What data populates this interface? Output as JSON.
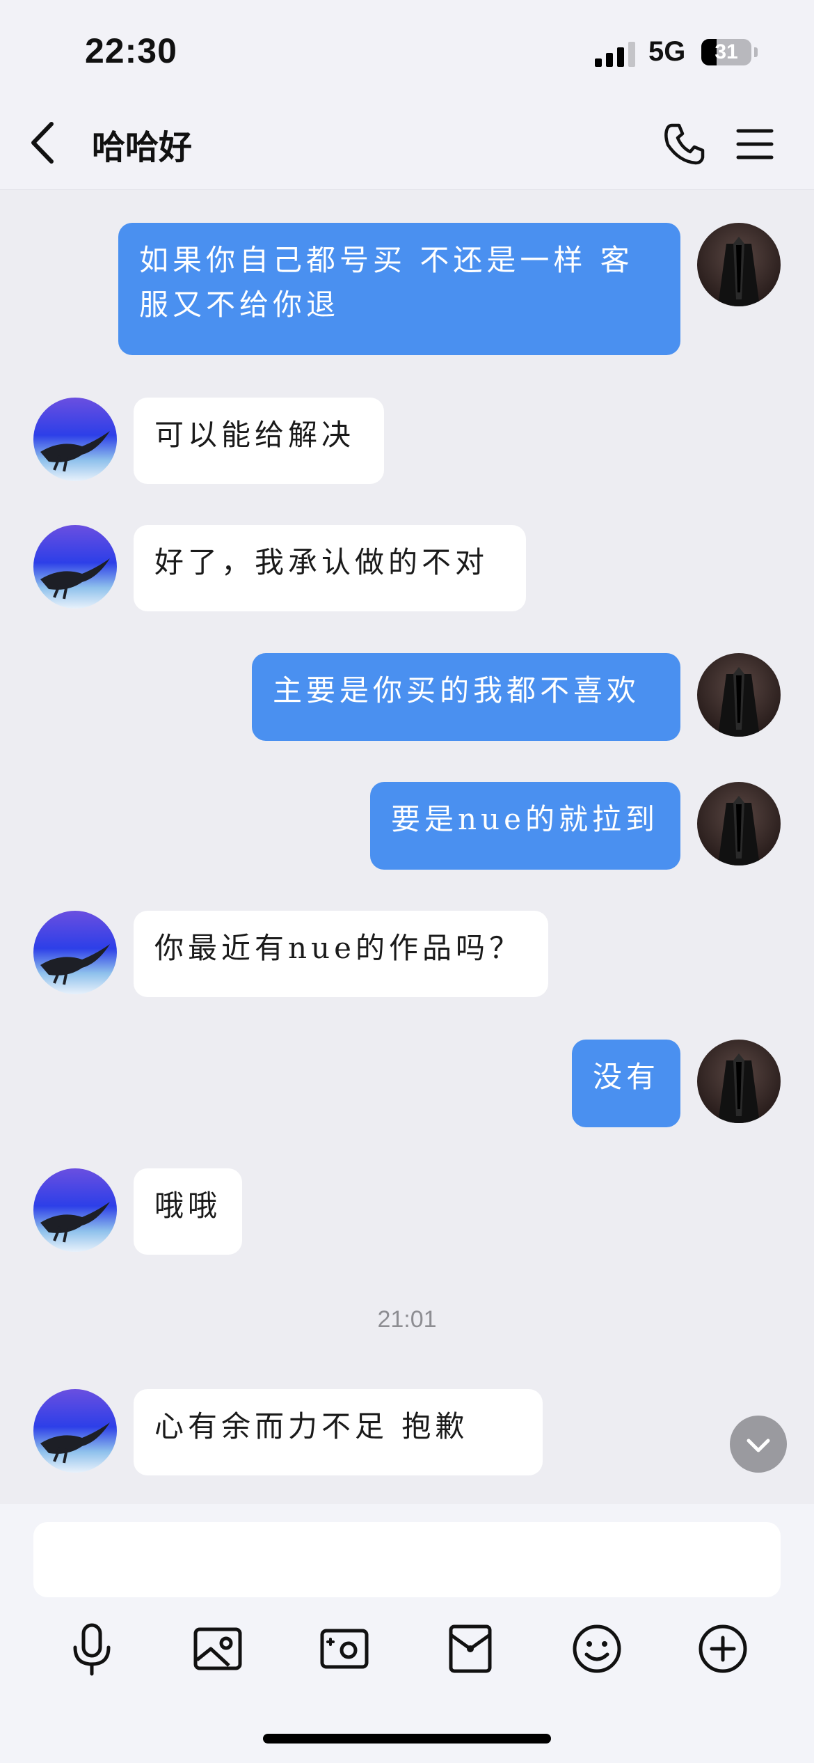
{
  "status_bar": {
    "time": "22:30",
    "network": "5G",
    "battery": "31"
  },
  "header": {
    "title": "哈哈好"
  },
  "messages": [
    {
      "side": "me",
      "text": "如果你自己都号买 不还是一样 客服又不给你退"
    },
    {
      "side": "friend",
      "text": "可以能给解决"
    },
    {
      "side": "friend",
      "text": "好了，我承认做的不对"
    },
    {
      "side": "me",
      "text": "主要是你买的我都不喜欢"
    },
    {
      "side": "me",
      "text": "要是nue的就拉到"
    },
    {
      "side": "friend",
      "text": "你最近有nue的作品吗？"
    },
    {
      "side": "me",
      "text": "没有"
    },
    {
      "side": "friend",
      "text": "哦哦"
    },
    {
      "side": "friend",
      "text": "心有余而力不足 抱歉"
    }
  ],
  "timestamp": "21:01",
  "composer": {
    "value": "",
    "placeholder": ""
  },
  "icons": {
    "back": "chevron-left-icon",
    "phone": "phone-icon",
    "menu": "menu-icon",
    "scroll_down": "chevron-down-icon",
    "tools": [
      "microphone-icon",
      "image-icon",
      "camera-icon",
      "red-packet-icon",
      "emoji-icon",
      "plus-icon"
    ]
  },
  "colors": {
    "my_bubble": "#4a90f0",
    "friend_bubble": "#ffffff",
    "background": "#ededf2"
  }
}
